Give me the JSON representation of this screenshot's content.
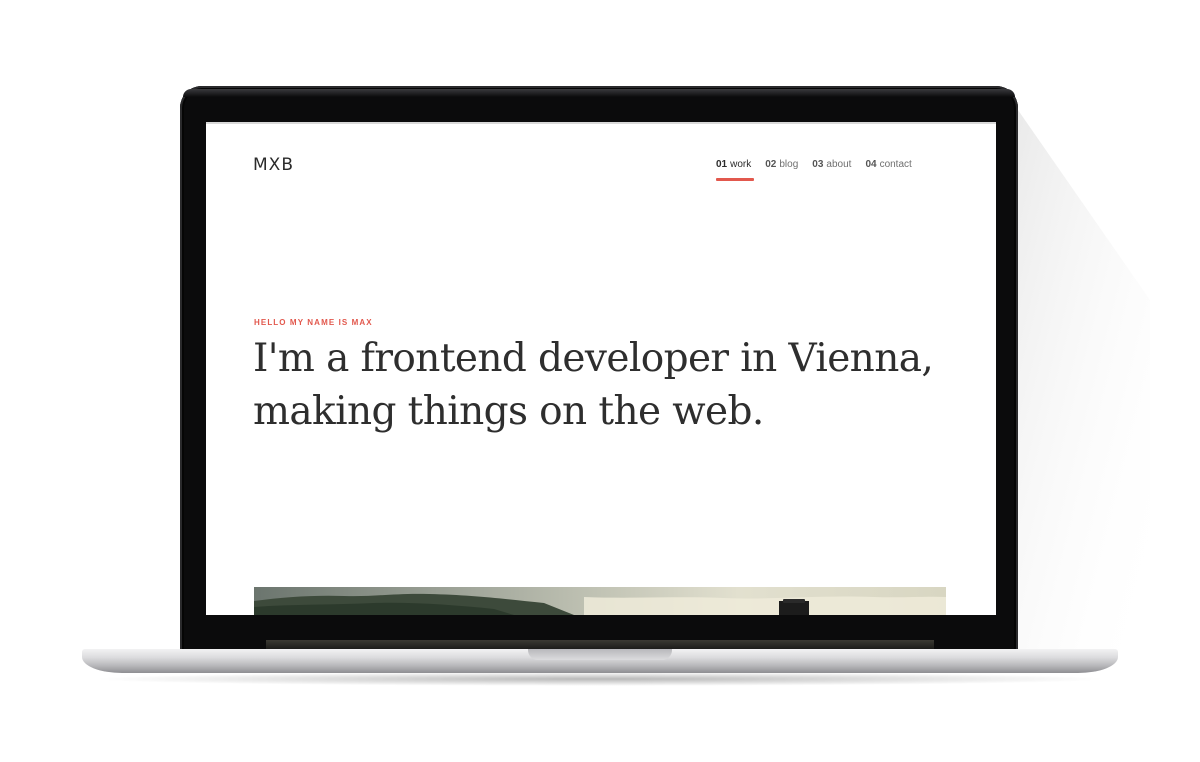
{
  "site": {
    "logo": "MXB",
    "nav": [
      {
        "num": "01",
        "label": "work",
        "active": true
      },
      {
        "num": "02",
        "label": "blog",
        "active": false
      },
      {
        "num": "03",
        "label": "about",
        "active": false
      },
      {
        "num": "04",
        "label": "contact",
        "active": false
      }
    ],
    "eyebrow": "HELLO MY NAME IS MAX",
    "headline": "I'm a frontend developer in Vienna, making things on the web."
  },
  "colors": {
    "accent": "#e2584d",
    "text": "#2e2e2e",
    "bezel": "#0b0b0c",
    "background": "#ffffff"
  }
}
